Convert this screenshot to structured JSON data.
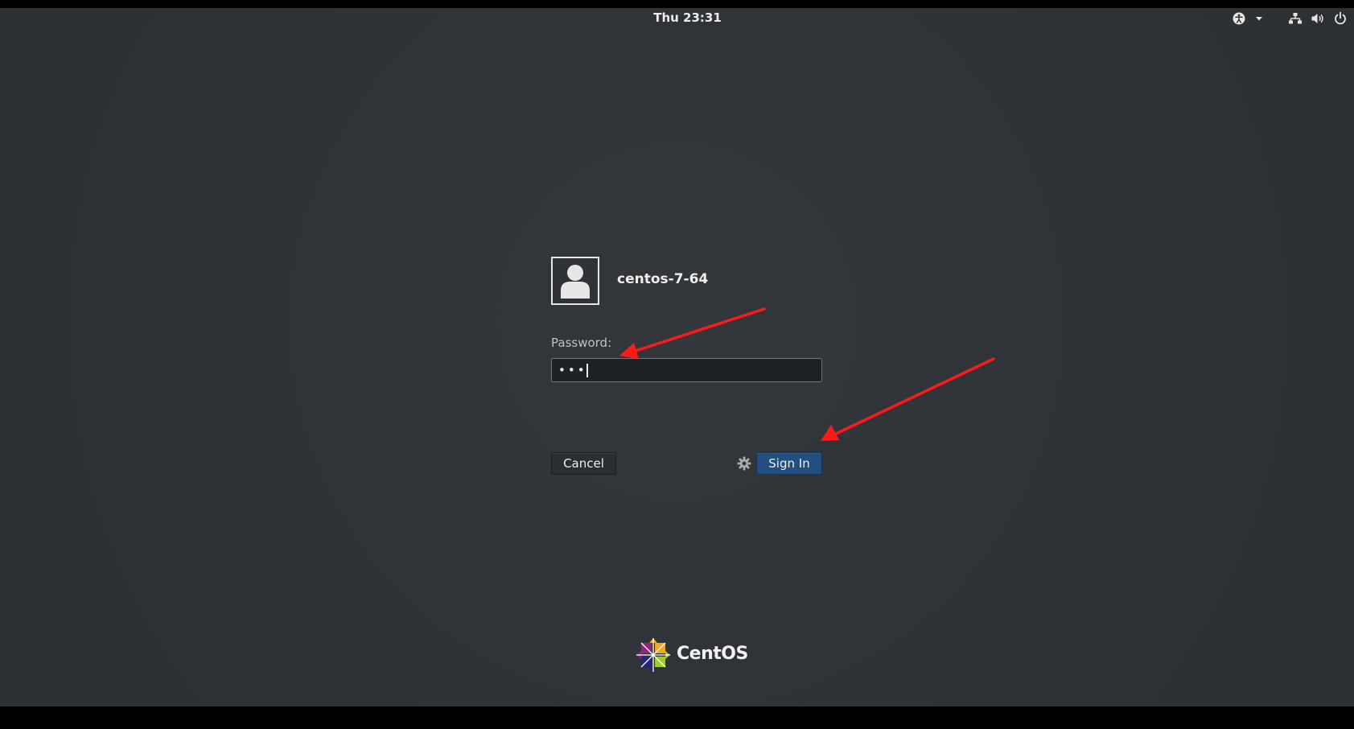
{
  "topbar": {
    "clock": "Thu 23:31",
    "accessibility_icon": "accessibility-icon",
    "menu_arrow_icon": "dropdown-arrow-icon",
    "network_icon": "network-wired-icon",
    "volume_icon": "volume-icon",
    "power_icon": "power-icon"
  },
  "login": {
    "avatar_icon": "user-avatar-icon",
    "username": "centos-7-64",
    "password_label": "Password:",
    "password_value": "•••",
    "cancel_label": "Cancel",
    "signin_label": "Sign In",
    "session_icon": "gear-icon"
  },
  "branding": {
    "logo_icon": "centos-logo-icon",
    "name": "CentOS"
  },
  "annotations": {
    "arrow_color": "#ff1a1a"
  },
  "colors": {
    "background": "#2f3337",
    "signin_button": "#214f80"
  }
}
